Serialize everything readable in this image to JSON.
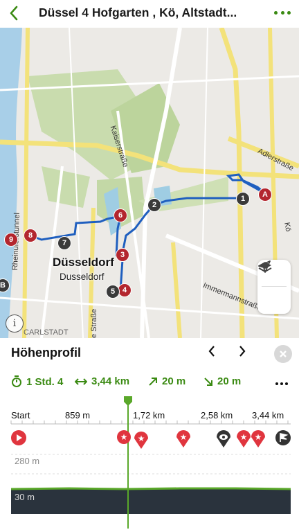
{
  "header": {
    "title": "Düssel 4 Hofgarten , Kö, Altstadt...",
    "back_icon": "chevron-left-icon",
    "menu_icon": "more-horizontal-icon"
  },
  "map": {
    "city_label": "Düsseldorf",
    "city_label_local": "Dusseldorf",
    "street_labels": [
      "Kaiserstraße",
      "Adlerstraße",
      "Immermannstraße",
      "Rheinuferstunnel",
      "Kö",
      "e Straße",
      "CARLSTADT"
    ],
    "waypoints": [
      "A",
      "1",
      "2",
      "3",
      "4",
      "5",
      "6",
      "7",
      "8",
      "9",
      "B"
    ],
    "layers_icon": "layers-icon",
    "locate_icon": "navigation-arrow-icon",
    "info_icon": "info-icon"
  },
  "profile": {
    "title": "Höhenprofil",
    "prev_icon": "chevron-left-icon",
    "next_icon": "chevron-right-icon",
    "close_icon": "close-icon",
    "stats": {
      "duration": "1 Std. 4",
      "distance": "3,44 km",
      "ascent": "20 m",
      "descent": "20 m"
    },
    "distance_ticks": [
      "Start",
      "859 m",
      "1,72 km",
      "2,58 km",
      "3,44 km"
    ],
    "elevation_max_label": "280 m",
    "elevation_min_label": "30 m",
    "poi_icons": [
      "play-icon",
      "star-icon",
      "star-icon",
      "star-icon",
      "eye-icon",
      "star-icon",
      "star-icon",
      "finish-flag-icon"
    ],
    "cursor_progress": 0.42,
    "colors": {
      "accent": "#3a8a12",
      "poi_red": "#e0353e",
      "route_blue": "#1f5fbf",
      "profile_dark": "#2a333d"
    }
  }
}
